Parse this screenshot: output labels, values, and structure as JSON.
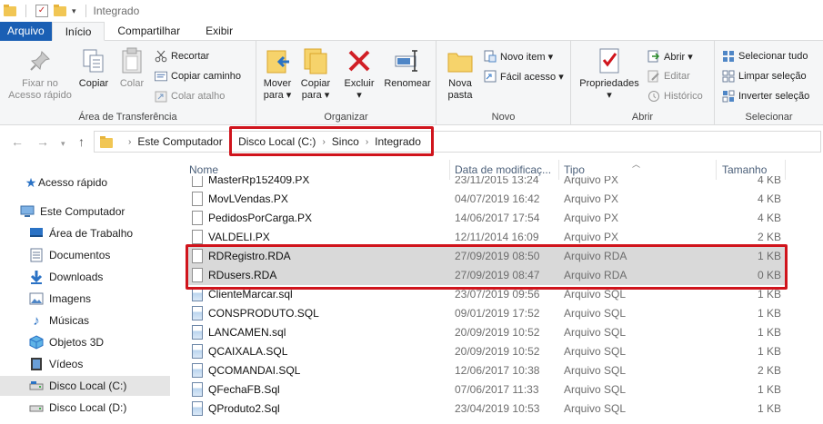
{
  "window": {
    "title": "Integrado"
  },
  "tabs": [
    "Arquivo",
    "Início",
    "Compartilhar",
    "Exibir"
  ],
  "ribbon": {
    "clipboard": {
      "label": "Área de Transferência",
      "pin": "Fixar no\nAcesso rápido",
      "copy": "Copiar",
      "paste": "Colar",
      "cut": "Recortar",
      "copy_path": "Copiar caminho",
      "paste_shortcut": "Colar atalho"
    },
    "organize": {
      "label": "Organizar",
      "move": "Mover\npara ▾",
      "copy_to": "Copiar\npara ▾",
      "delete": "Excluir\n▾",
      "rename": "Renomear"
    },
    "new": {
      "label": "Novo",
      "new_folder": "Nova\npasta",
      "new_item": "Novo item ▾",
      "easy_access": "Fácil acesso ▾"
    },
    "open": {
      "label": "Abrir",
      "properties": "Propriedades\n▾",
      "open": "Abrir ▾",
      "edit": "Editar",
      "history": "Histórico"
    },
    "select": {
      "label": "Selecionar",
      "select_all": "Selecionar tudo",
      "select_none": "Limpar seleção",
      "invert": "Inverter seleção"
    }
  },
  "breadcrumb": [
    "Este Computador",
    "Disco Local (C:)",
    "Sinco",
    "Integrado"
  ],
  "nav": [
    {
      "label": "Acesso rápido",
      "icon": "star-icon"
    },
    {
      "label": "Este Computador",
      "icon": "computer-icon"
    },
    {
      "label": "Área de Trabalho",
      "icon": "desktop-icon"
    },
    {
      "label": "Documentos",
      "icon": "documents-icon"
    },
    {
      "label": "Downloads",
      "icon": "download-icon"
    },
    {
      "label": "Imagens",
      "icon": "pictures-icon"
    },
    {
      "label": "Músicas",
      "icon": "music-icon"
    },
    {
      "label": "Objetos 3D",
      "icon": "objects-3d-icon"
    },
    {
      "label": "Vídeos",
      "icon": "videos-icon"
    },
    {
      "label": "Disco Local (C:)",
      "icon": "drive-icon"
    },
    {
      "label": "Disco Local (D:)",
      "icon": "drive-icon"
    }
  ],
  "columns": {
    "name": "Nome",
    "date": "Data de modificaç...",
    "type": "Tipo",
    "size": "Tamanho"
  },
  "files": [
    {
      "name": "MasterRp152409.PX",
      "date": "23/11/2015 13:24",
      "type": "Arquivo PX",
      "size": "4 KB",
      "icon": "doc"
    },
    {
      "name": "MovLVendas.PX",
      "date": "04/07/2019 16:42",
      "type": "Arquivo PX",
      "size": "4 KB",
      "icon": "doc"
    },
    {
      "name": "PedidosPorCarga.PX",
      "date": "14/06/2017 17:54",
      "type": "Arquivo PX",
      "size": "4 KB",
      "icon": "doc"
    },
    {
      "name": "VALDELI.PX",
      "date": "12/11/2014 16:09",
      "type": "Arquivo PX",
      "size": "2 KB",
      "icon": "doc"
    },
    {
      "name": "RDRegistro.RDA",
      "date": "27/09/2019 08:50",
      "type": "Arquivo RDA",
      "size": "1 KB",
      "icon": "doc"
    },
    {
      "name": "RDusers.RDA",
      "date": "27/09/2019 08:47",
      "type": "Arquivo RDA",
      "size": "0 KB",
      "icon": "doc"
    },
    {
      "name": "ClienteMarcar.sql",
      "date": "23/07/2019 09:56",
      "type": "Arquivo SQL",
      "size": "1 KB",
      "icon": "sql"
    },
    {
      "name": "CONSPRODUTO.SQL",
      "date": "09/01/2019 17:52",
      "type": "Arquivo SQL",
      "size": "1 KB",
      "icon": "sql"
    },
    {
      "name": "LANCAMEN.sql",
      "date": "20/09/2019 10:52",
      "type": "Arquivo SQL",
      "size": "1 KB",
      "icon": "sql"
    },
    {
      "name": "QCAIXALA.SQL",
      "date": "20/09/2019 10:52",
      "type": "Arquivo SQL",
      "size": "1 KB",
      "icon": "sql"
    },
    {
      "name": "QCOMANDAI.SQL",
      "date": "12/06/2017 10:38",
      "type": "Arquivo SQL",
      "size": "2 KB",
      "icon": "sql"
    },
    {
      "name": "QFechaFB.Sql",
      "date": "07/06/2017 11:33",
      "type": "Arquivo SQL",
      "size": "1 KB",
      "icon": "sql"
    },
    {
      "name": "QProduto2.Sql",
      "date": "23/04/2019 10:53",
      "type": "Arquivo SQL",
      "size": "1 KB",
      "icon": "sql"
    }
  ]
}
